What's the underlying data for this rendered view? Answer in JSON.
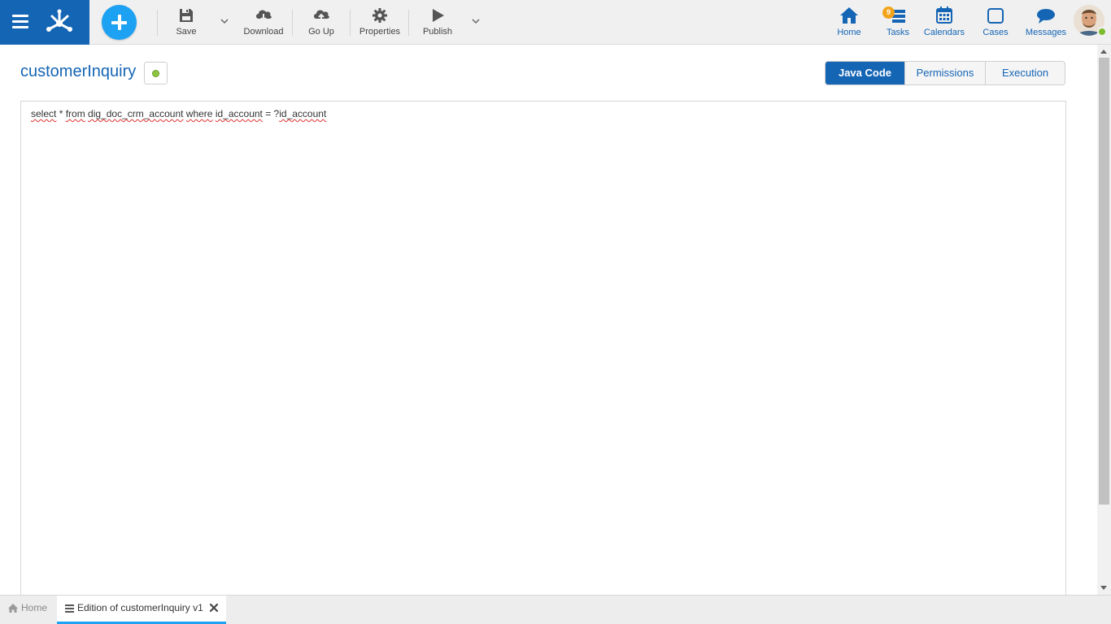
{
  "toolbar": {
    "save_label": "Save",
    "download_label": "Download",
    "goup_label": "Go Up",
    "properties_label": "Properties",
    "publish_label": "Publish"
  },
  "nav": {
    "home_label": "Home",
    "tasks_label": "Tasks",
    "tasks_badge": "9",
    "calendars_label": "Calendars",
    "cases_label": "Cases",
    "messages_label": "Messages"
  },
  "page": {
    "title": "customerInquiry"
  },
  "tabs": [
    {
      "label": "Java Code",
      "active": true
    },
    {
      "label": "Permissions",
      "active": false
    },
    {
      "label": "Execution",
      "active": false
    }
  ],
  "editor": {
    "tokens": [
      "select",
      " * ",
      "from",
      " ",
      "dig_doc_crm_account",
      " ",
      "where",
      " ",
      "id_account",
      " = ?",
      "id_account"
    ]
  },
  "bottom_tabs": {
    "home_label": "Home",
    "edition_label": "Edition of customerInquiry v1"
  },
  "colors": {
    "brand": "#1565b5",
    "accent": "#1da1f2",
    "status_green": "#8dc63f",
    "badge_orange": "#f2a31a"
  }
}
